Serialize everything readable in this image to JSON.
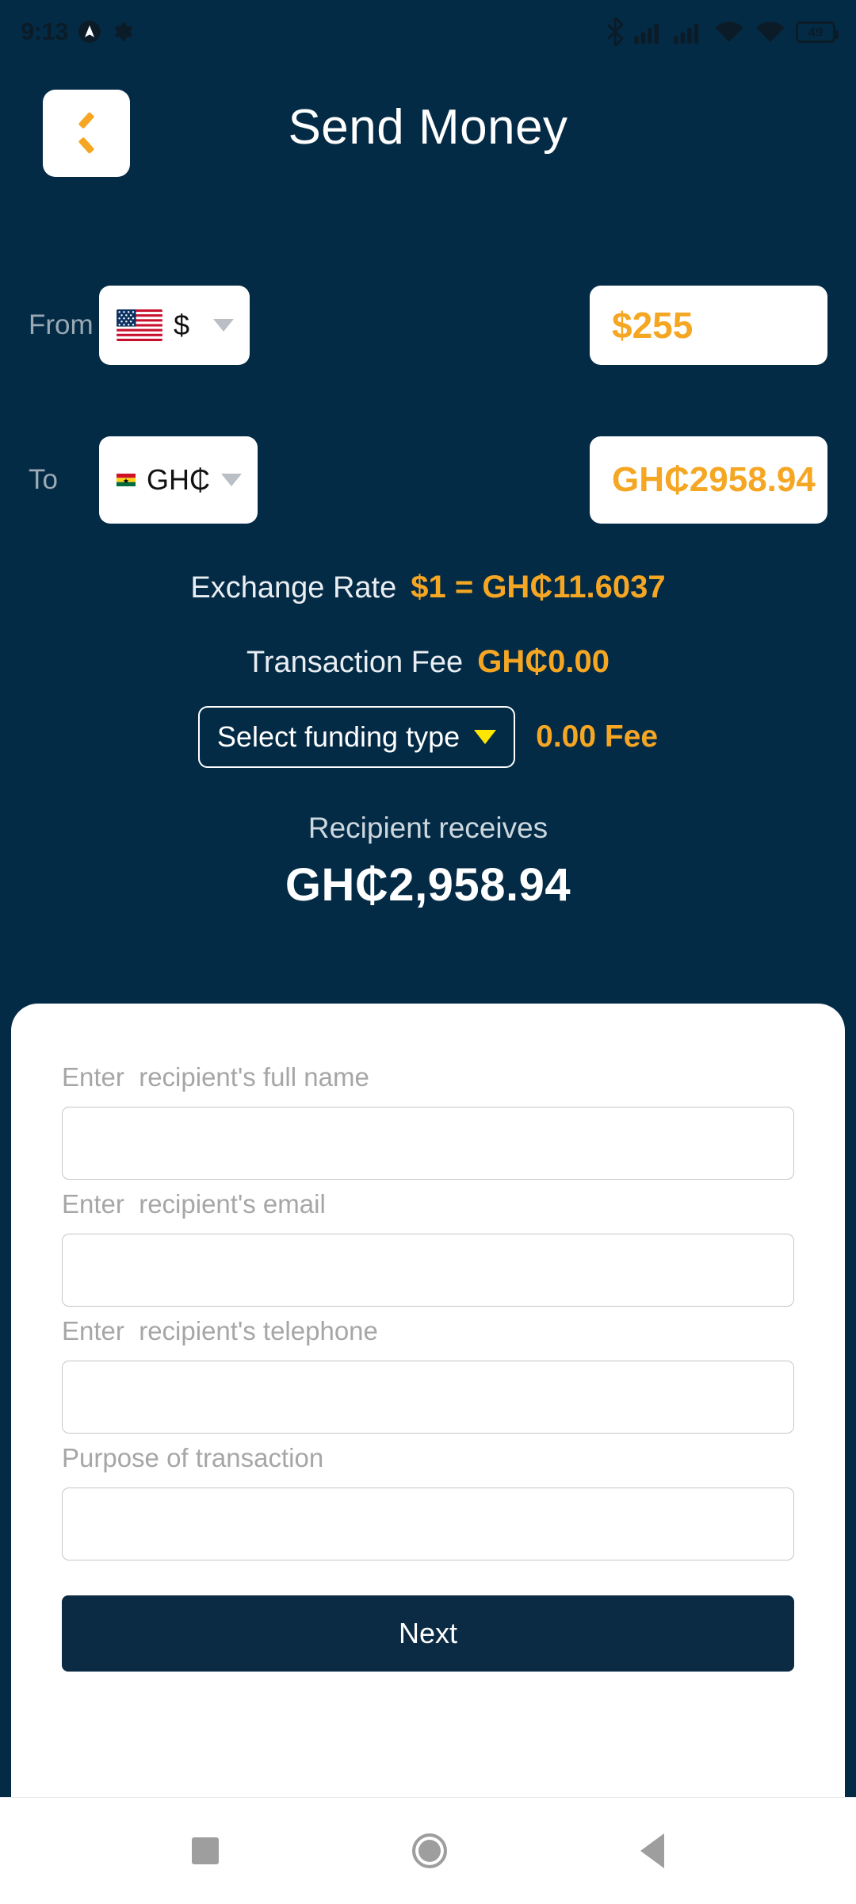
{
  "status_bar": {
    "time": "9:13",
    "left_icons": [
      "app-badge-icon",
      "gear-icon"
    ],
    "right_icons": [
      "bluetooth-icon",
      "signal-bars-icon",
      "signal-bars-2-icon",
      "wifi-icon",
      "wifi-2-icon"
    ],
    "battery_level": "49"
  },
  "header": {
    "back_icon": "chevron-left-icon",
    "title": "Send Money"
  },
  "converter": {
    "from": {
      "label": "From",
      "flag": "us-flag-icon",
      "currency_code": "$",
      "chevron": "chevron-down-icon",
      "amount": "$255"
    },
    "to": {
      "label": "To",
      "flag": "ghana-flag-icon",
      "currency_code": "GH₵",
      "chevron": "chevron-down-icon",
      "amount": "GH₵2958.94"
    }
  },
  "summary": {
    "exchange_rate_label": "Exchange Rate",
    "exchange_rate_value": "$1 = GH₵11.6037",
    "transaction_fee_label": "Transaction Fee",
    "transaction_fee_value": "GH₵0.00",
    "funding_type_placeholder": "Select funding type",
    "funding_type_chevron": "chevron-down-icon",
    "funding_fee": "0.00 Fee",
    "recipient_receives_label": "Recipient receives",
    "recipient_receives_amount": "GH₵2,958.94"
  },
  "form": {
    "fields": [
      {
        "label": "Enter  recipient's full name",
        "value": "",
        "placeholder": ""
      },
      {
        "label": "Enter  recipient's email",
        "value": "",
        "placeholder": ""
      },
      {
        "label": "Enter  recipient's telephone",
        "value": "",
        "placeholder": ""
      },
      {
        "label": "Purpose of transaction",
        "value": "",
        "placeholder": ""
      }
    ],
    "submit_label": "Next"
  },
  "nav_bar": {
    "recents_icon": "square-recents-icon",
    "home_icon": "circle-home-icon",
    "back_icon": "triangle-back-icon"
  },
  "colors": {
    "background": "#042b46",
    "accent": "#f5a623",
    "card": "#ffffff",
    "button": "#0b2b44",
    "chevron_yellow": "#ffe600"
  }
}
